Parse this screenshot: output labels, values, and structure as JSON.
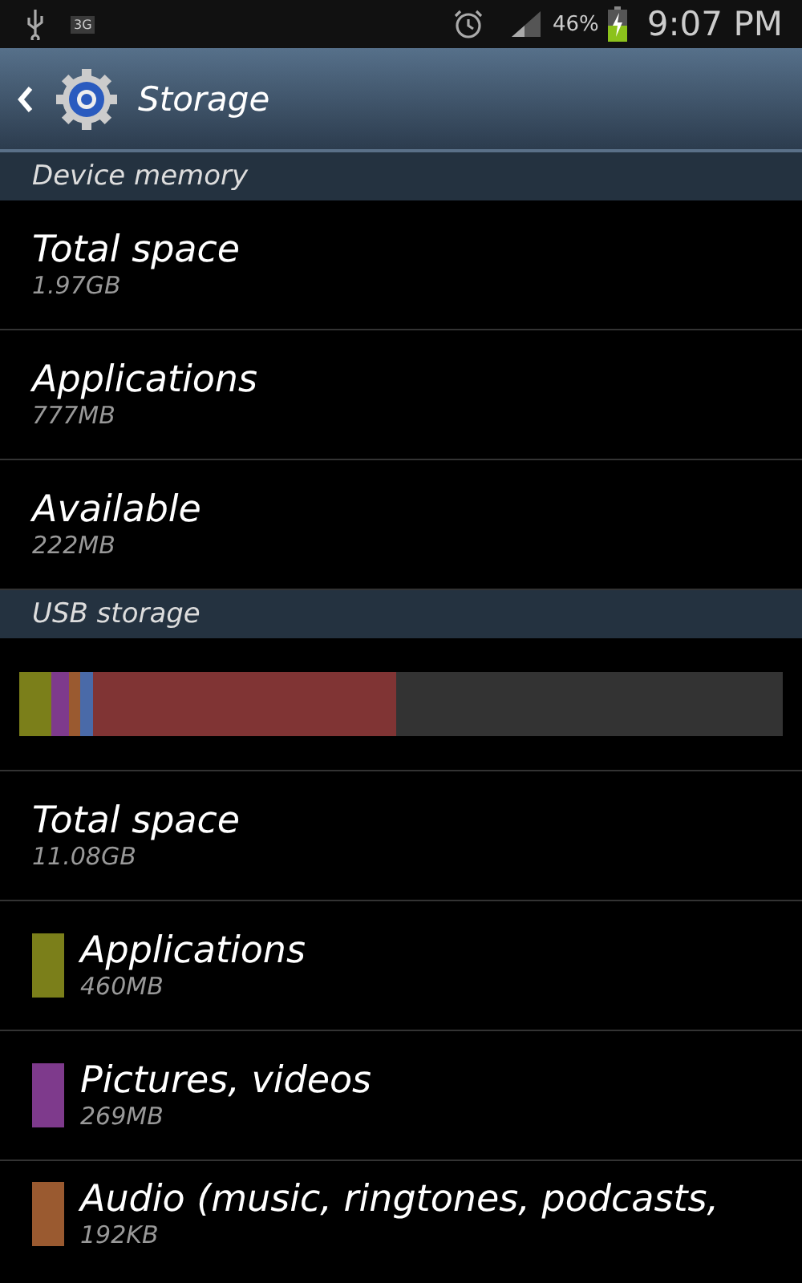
{
  "status_bar": {
    "network": "3G",
    "battery": "46%",
    "time": "9:07 PM"
  },
  "action_bar": {
    "title": "Storage"
  },
  "sections": [
    {
      "header": "Device memory",
      "items": [
        {
          "kind": "plain",
          "title": "Total space",
          "size": "1.97GB"
        },
        {
          "kind": "plain",
          "title": "Applications",
          "size": "777MB"
        },
        {
          "kind": "plain",
          "title": "Available",
          "size": "222MB"
        }
      ]
    },
    {
      "header": "USB storage",
      "usage_bar": [
        {
          "color": "#7b7f1a"
        },
        {
          "color": "#7e3a8c"
        },
        {
          "color": "#9a5a30"
        },
        {
          "color": "#4a6aa8"
        },
        {
          "color": "#803434"
        }
      ],
      "items": [
        {
          "kind": "plain",
          "title": "Total space",
          "size": "11.08GB"
        },
        {
          "kind": "legend",
          "color": "#7b7f1a",
          "title": "Applications",
          "size": "460MB"
        },
        {
          "kind": "legend",
          "color": "#7e3a8c",
          "title": "Pictures, videos",
          "size": "269MB"
        },
        {
          "kind": "legend",
          "color": "#9a5a30",
          "title": "Audio (music, ringtones, podcasts,",
          "size": "192KB"
        }
      ]
    }
  ]
}
